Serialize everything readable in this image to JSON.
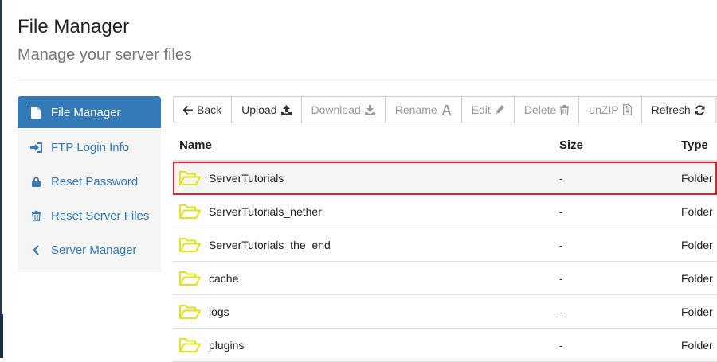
{
  "header": {
    "title": "File Manager",
    "subtitle": "Manage your server files"
  },
  "sidebar": {
    "items": [
      {
        "label": "File Manager",
        "icon": "file-icon",
        "active": true
      },
      {
        "label": "FTP Login Info",
        "icon": "sign-in-icon",
        "active": false
      },
      {
        "label": "Reset Password",
        "icon": "lock-icon",
        "active": false
      },
      {
        "label": "Reset Server Files",
        "icon": "trash-icon",
        "active": false
      },
      {
        "label": "Server Manager",
        "icon": "chevron-left-icon",
        "active": false
      }
    ]
  },
  "toolbar": {
    "back_label": "Back",
    "upload_label": "Upload",
    "download_label": "Download",
    "rename_label": "Rename",
    "edit_label": "Edit",
    "delete_label": "Delete",
    "unzip_label": "unZIP",
    "refresh_label": "Refresh",
    "path_label": "/"
  },
  "table": {
    "headers": {
      "name": "Name",
      "size": "Size",
      "type": "Type"
    },
    "rows": [
      {
        "name": "ServerTutorials",
        "size": "-",
        "type": "Folder",
        "selected": true
      },
      {
        "name": "ServerTutorials_nether",
        "size": "-",
        "type": "Folder"
      },
      {
        "name": "ServerTutorials_the_end",
        "size": "-",
        "type": "Folder"
      },
      {
        "name": "cache",
        "size": "-",
        "type": "Folder"
      },
      {
        "name": "logs",
        "size": "-",
        "type": "Folder"
      },
      {
        "name": "plugins",
        "size": "-",
        "type": "Folder"
      }
    ]
  },
  "colors": {
    "accent": "#337ab7",
    "selected_outline": "#d9232e",
    "folder_icon": "#e3e21b"
  }
}
